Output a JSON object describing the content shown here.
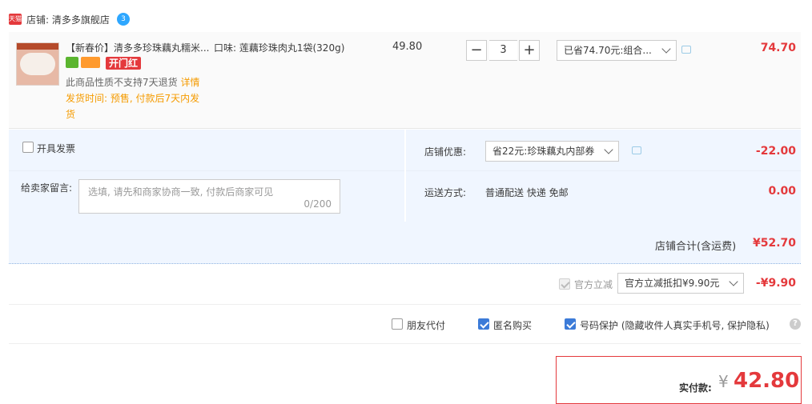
{
  "store": {
    "badge": "天猫",
    "label": "店铺: 清多多旗舰店",
    "chat_badge": "3"
  },
  "item": {
    "title": "【新春价】清多多珍珠藕丸糯米...",
    "tag": "开门红",
    "notice": "此商品性质不支持7天退货",
    "notice_link": "详情",
    "shipping_line1": "发货时间: 预售, 付款后7天内发",
    "shipping_line2": "货",
    "sku": "口味: 莲藕珍珠肉丸1袋(320g)",
    "unit_price": "49.80",
    "minus": "−",
    "plus": "+",
    "quantity": "3",
    "promo_select": "已省74.70元:组合...",
    "subtotal": "74.70"
  },
  "invoice": {
    "label": "开具发票"
  },
  "message": {
    "label": "给卖家留言:",
    "placeholder": "选填, 请先和商家协商一致, 付款后商家可见",
    "count": "0/200"
  },
  "store_discount": {
    "label": "店铺优惠:",
    "select": "省22元:珍珠藕丸内部券",
    "amount": "-22.00"
  },
  "delivery": {
    "label": "运送方式:",
    "value": "普通配送 快递 免邮",
    "amount": "0.00"
  },
  "store_total": {
    "label": "店铺合计(含运费)",
    "amount": "¥52.70"
  },
  "official_discount": {
    "label": "官方立减",
    "select": "官方立减抵扣¥9.90元",
    "amount": "-¥9.90"
  },
  "options": {
    "friend_pay": "朋友代付",
    "anonymous": "匿名购买",
    "privacy": "号码保护 (隐藏收件人真实手机号, 保护隐私)",
    "help": "?"
  },
  "final": {
    "label": "实付款:",
    "currency": "¥",
    "amount": "42.80"
  },
  "colors": {
    "accent_red": "#e4393c",
    "panel_blue": "#f0f6ff",
    "checkbox_blue": "#3c7bd8",
    "warning_orange": "#f59b00"
  }
}
